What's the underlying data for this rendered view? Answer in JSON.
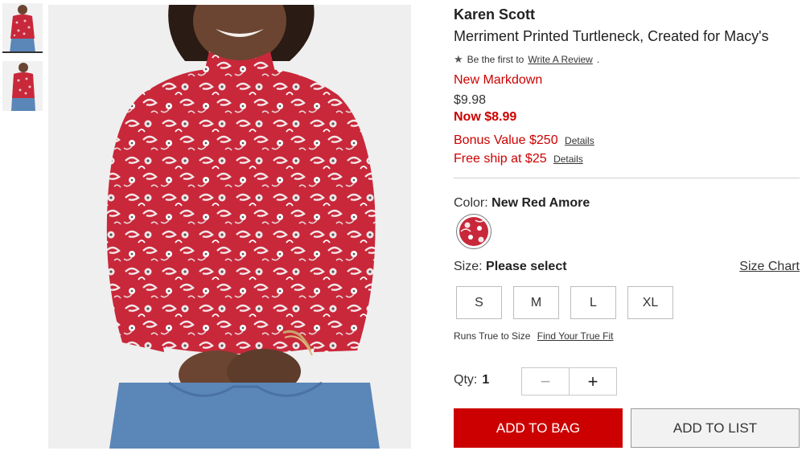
{
  "gallery": {
    "thumbnails": [
      {
        "alt": "front view",
        "selected": true
      },
      {
        "alt": "alternate view",
        "selected": false
      }
    ]
  },
  "product": {
    "brand": "Karen Scott",
    "title": "Merriment Printed Turtleneck, Created for Macy's",
    "review_prefix": "Be the first to",
    "review_link": "Write A Review",
    "review_suffix": ".",
    "markdown_label": "New Markdown",
    "original_price": "$9.98",
    "now_price": "Now $8.99",
    "promos": [
      {
        "text": "Bonus Value $250",
        "details": "Details"
      },
      {
        "text": "Free ship at $25",
        "details": "Details"
      }
    ]
  },
  "color": {
    "label": "Color:",
    "selected": "New Red Amore",
    "swatch_color": "#c8283a"
  },
  "size": {
    "label": "Size:",
    "prompt": "Please select",
    "chart_link": "Size Chart",
    "options": [
      "S",
      "M",
      "L",
      "XL"
    ],
    "fit_text": "Runs True to Size",
    "fit_link": "Find Your True Fit"
  },
  "quantity": {
    "label": "Qty:",
    "value": "1",
    "minus": "−",
    "plus": "+"
  },
  "actions": {
    "add_to_bag": "ADD TO BAG",
    "add_to_list": "ADD TO LIST"
  },
  "colors": {
    "accent_red": "#cc0000",
    "shirt_red": "#c8283a",
    "jeans_blue": "#5b86b8"
  }
}
